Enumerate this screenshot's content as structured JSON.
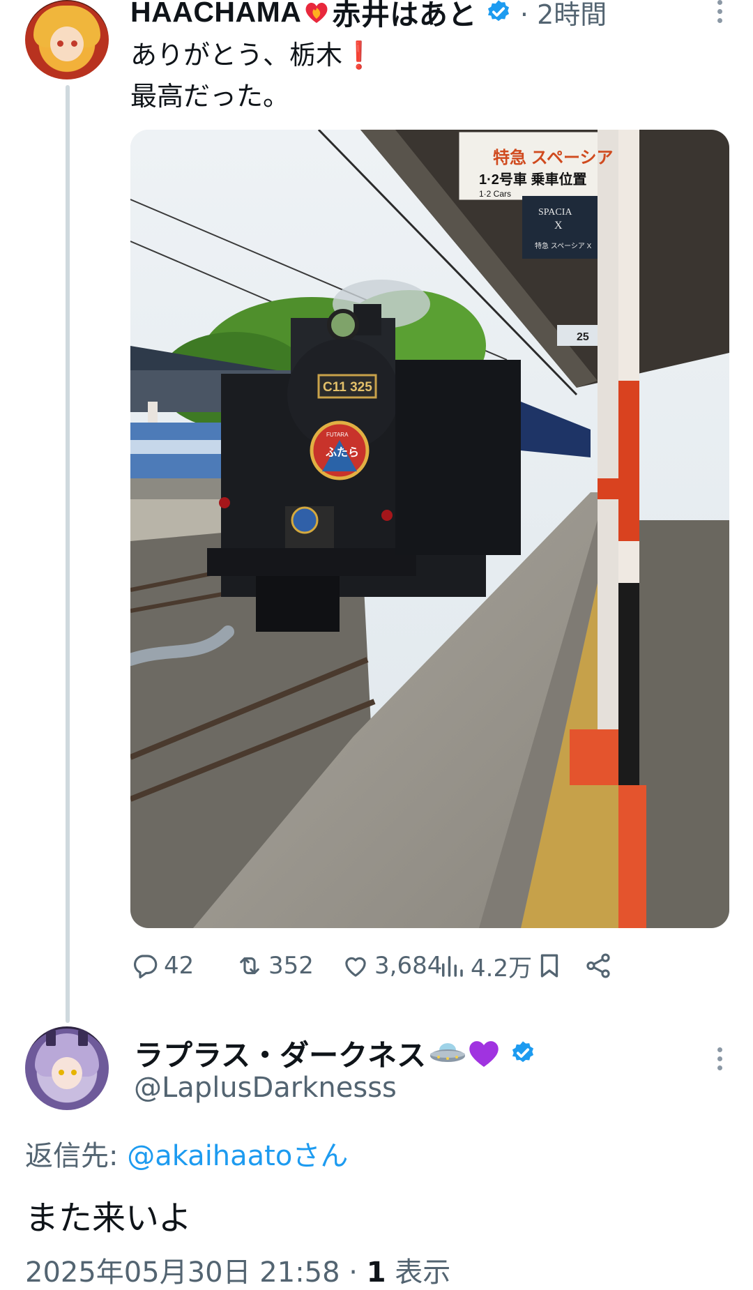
{
  "tweet": {
    "display_name": "HAACHAMA",
    "display_name_suffix": "赤井はあと",
    "time": "· 2時間",
    "text_line1": "ありがとう、栃木",
    "text_line1_emoji": "❗",
    "text_line2": "最高だった。",
    "photo": {
      "station_sign_title": "特急 スペーシア",
      "station_sign_sub": "1·2号車 乗車位置",
      "station_sign_en": "1·2 Cars",
      "spacia_sign": "SPACIA",
      "spacia_sign_x": "X",
      "spacia_sign_sub": "特急 スペーシア X",
      "platform_number": "25",
      "locomotive_plate": "C11 325",
      "headmark_top": "FUTARA",
      "headmark_text": "ふたら"
    },
    "actions": {
      "replies": "42",
      "reposts": "352",
      "likes": "3,684",
      "views": "4.2万"
    }
  },
  "reply": {
    "display_name": "ラプラス・ダークネス",
    "handle": "@LaplusDarknesss",
    "replying_to_label": "返信先: ",
    "replying_to_handle": "@akaihaatoさん",
    "text": "また来いよ",
    "timestamp": "2025年05月30日 21:58 · ",
    "views_count": "1",
    "views_label": " 表示"
  },
  "colors": {
    "text": "#0f1419",
    "secondary": "#536471",
    "link": "#1d9bf0",
    "verified": "#1d9bf0",
    "thread_line": "#cfd9de"
  }
}
